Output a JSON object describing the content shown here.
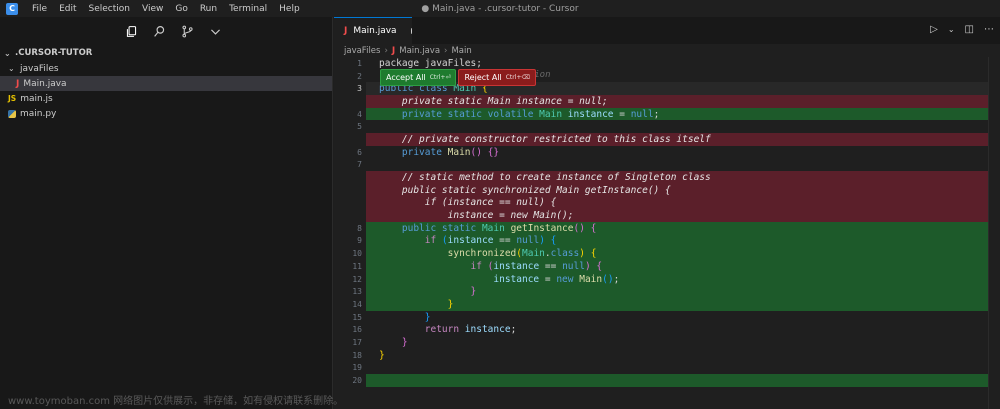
{
  "titlebar": {
    "menu": [
      "File",
      "Edit",
      "Selection",
      "View",
      "Go",
      "Run",
      "Terminal",
      "Help"
    ],
    "window_title": "● Main.java - .cursor-tutor - Cursor"
  },
  "sidebar": {
    "root": ".CURSOR-TUTOR",
    "folder": "javaFiles",
    "files": [
      {
        "name": "Main.java",
        "selected": true
      },
      {
        "name": "main.js"
      },
      {
        "name": "main.py"
      }
    ]
  },
  "editor": {
    "tab_label": "Main.java",
    "breadcrumb": [
      "javaFiles",
      "Main.java",
      "Main"
    ],
    "accept_label": "Accept All",
    "accept_hint": "Ctrl+⏎",
    "reject_label": "Reject All",
    "reject_hint": "Ctrl+⌫",
    "inline_hint": "tation"
  },
  "watermark": "www.toymoban.com 网络图片仅供展示，非存储，如有侵权请联系删除。"
}
